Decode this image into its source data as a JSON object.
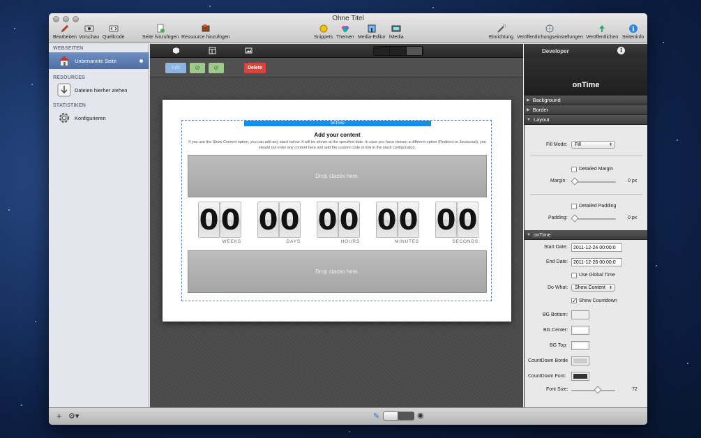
{
  "window": {
    "title": "Ohne Titel"
  },
  "toolbar": {
    "bearbeiten": "Bearbeiten",
    "vorschau": "Vorschau",
    "quellcode": "Quellcode",
    "seite_hinzufuegen": "Seite hinzufügen",
    "ressource_hinzufuegen": "Ressource hinzufügen",
    "snippets": "Snippets",
    "themen": "Themen",
    "media_editor": "Media-Editor",
    "imedia": "iMedia",
    "einrichtung": "Einrichtung",
    "veroeffentlichungseinstellungen": "Veröffentlichungseinstellungen",
    "veroeffentlichen": "Veröffentlichen",
    "seiteninfo": "Seiteninfo"
  },
  "sidebar": {
    "webseiten_header": "WEBSEITEN",
    "page_name": "Unbenannte Seite",
    "resources_header": "RESOURCES",
    "resources_item": "Dateien hierher ziehen",
    "statistiken_header": "STATISTIKEN",
    "statistiken_item": "Konfigurieren"
  },
  "actions": {
    "edit": "Edit",
    "delete": "Delete"
  },
  "stack": {
    "bar_label": "onTime",
    "title": "Add your content",
    "description": "If you use the Show Content option, you can add any stack below. It will be shown at the specified date. In case you have chosen a different option (Redirect or Javascript), you should not enter any content here and add the custom code or link in the stack configuration.",
    "drop_top": "Drop stacks here.",
    "drop_bottom": "Drop stacks here.",
    "countdown": [
      {
        "digits": [
          "0",
          "0"
        ],
        "label": "WEEKS"
      },
      {
        "digits": [
          "0",
          "0"
        ],
        "label": "DAYS"
      },
      {
        "digits": [
          "0",
          "0"
        ],
        "label": "HOURS"
      },
      {
        "digits": [
          "0",
          "0"
        ],
        "label": "MINUTES"
      },
      {
        "digits": [
          "0",
          "0"
        ],
        "label": "SECONDS"
      }
    ]
  },
  "inspector": {
    "top_label": "Developer",
    "info": "i",
    "stack_name": "onTime",
    "sections": {
      "background": "Background",
      "border": "Border",
      "layout": "Layout",
      "ontime": "onTime"
    },
    "fill_mode_label": "Fill Mode:",
    "fill_mode_value": "Fill",
    "detailed_margin": "Detailed Margin",
    "margin_label": "Margin:",
    "margin_value": "0 px",
    "detailed_padding": "Detailed Padding",
    "padding_label": "Padding:",
    "padding_value": "0 px",
    "start_date_label": "Start Date:",
    "start_date_value": "2011-12-24 00:00:0",
    "end_date_label": "End Date:",
    "end_date_value": "2011-12-26 00:00:0",
    "use_global_time": "Use Global Time",
    "do_what_label": "Do What:",
    "do_what_value": "Show Content",
    "show_countdown": "Show Countdown",
    "bg_bottom_label": "BG Bottom:",
    "bg_center_label": "BG Center:",
    "bg_top_label": "BG Top:",
    "countdown_border_label": "CountDown Borde",
    "countdown_font_label": "CountDown Font:",
    "font_size_label": "Font Size:",
    "font_size_value": "72",
    "font_size_fraction": 0.6,
    "colors": {
      "bg_bottom": "#eeeeee",
      "bg_center": "#ffffff",
      "bg_top": "#ffffff",
      "countdown_border": "#cccccc",
      "countdown_font": "#333333"
    }
  },
  "colors": {
    "accent": "#1e8ddf",
    "delete": "#d9443a",
    "sidebar_selected": "#5a79ad"
  }
}
